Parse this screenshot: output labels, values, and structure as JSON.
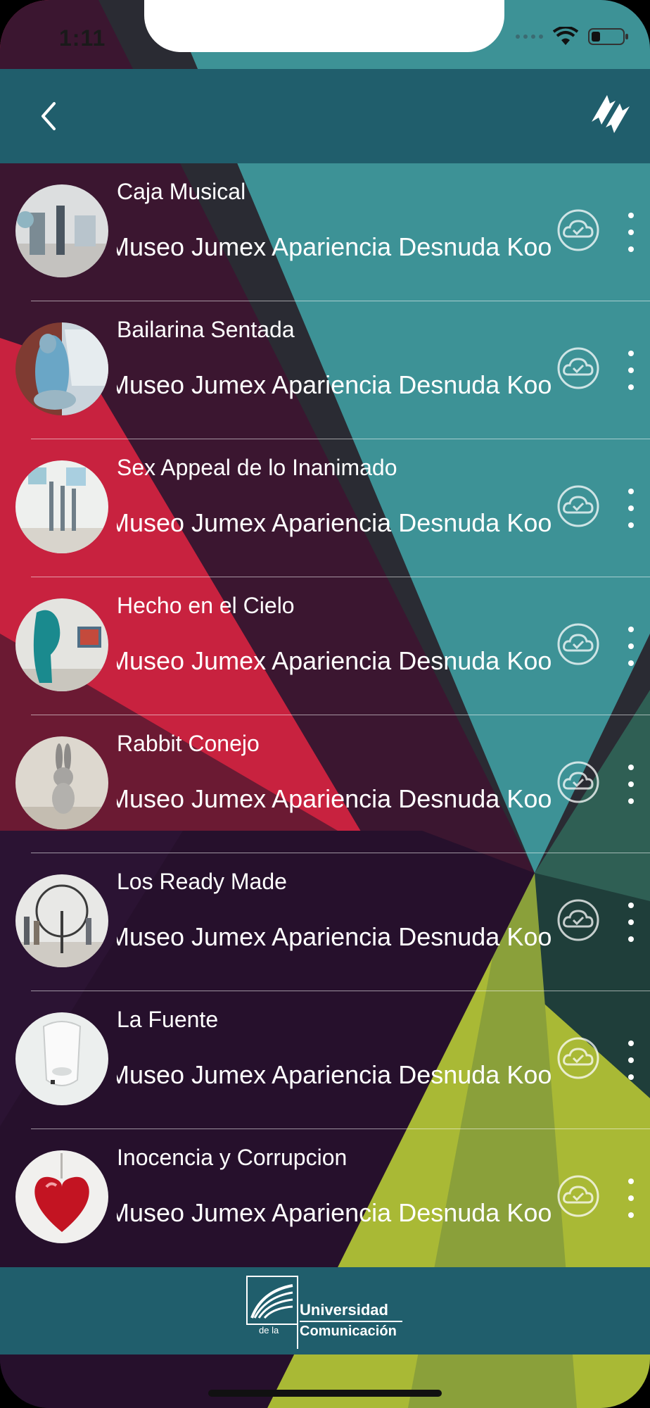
{
  "status_bar": {
    "time": "1:11"
  },
  "header": {
    "back_icon": "chevron-left-icon",
    "sync_icon": "sync-arrows-icon"
  },
  "items": [
    {
      "title": "Caja Musical",
      "subtitle": "Museo Jumex Apariencia Desnuda Koons"
    },
    {
      "title": "Bailarina Sentada",
      "subtitle": "Museo Jumex Apariencia Desnuda Koons"
    },
    {
      "title": "Sex Appeal de lo Inanimado",
      "subtitle": "Museo Jumex Apariencia Desnuda Koons"
    },
    {
      "title": "Hecho en el Cielo",
      "subtitle": "Museo Jumex Apariencia Desnuda Koons"
    },
    {
      "title": "Rabbit Conejo",
      "subtitle": "Museo Jumex Apariencia Desnuda Koons"
    },
    {
      "title": "Los Ready Made",
      "subtitle": "Museo Jumex Apariencia Desnuda Koons"
    },
    {
      "title": "La Fuente",
      "subtitle": "Museo Jumex Apariencia Desnuda Koons"
    },
    {
      "title": "Inocencia y Corrupcion",
      "subtitle": "Museo Jumex Apariencia Desnuda Koons"
    }
  ],
  "footer": {
    "logo_line1": "Universidad",
    "logo_small": "de la",
    "logo_line2": "Comunicación"
  },
  "colors": {
    "header_bg": "#205e6c",
    "accent_teal": "#3a9aa0",
    "accent_red": "#d42b4a",
    "accent_lime": "#b5c433",
    "text": "#ffffff"
  }
}
